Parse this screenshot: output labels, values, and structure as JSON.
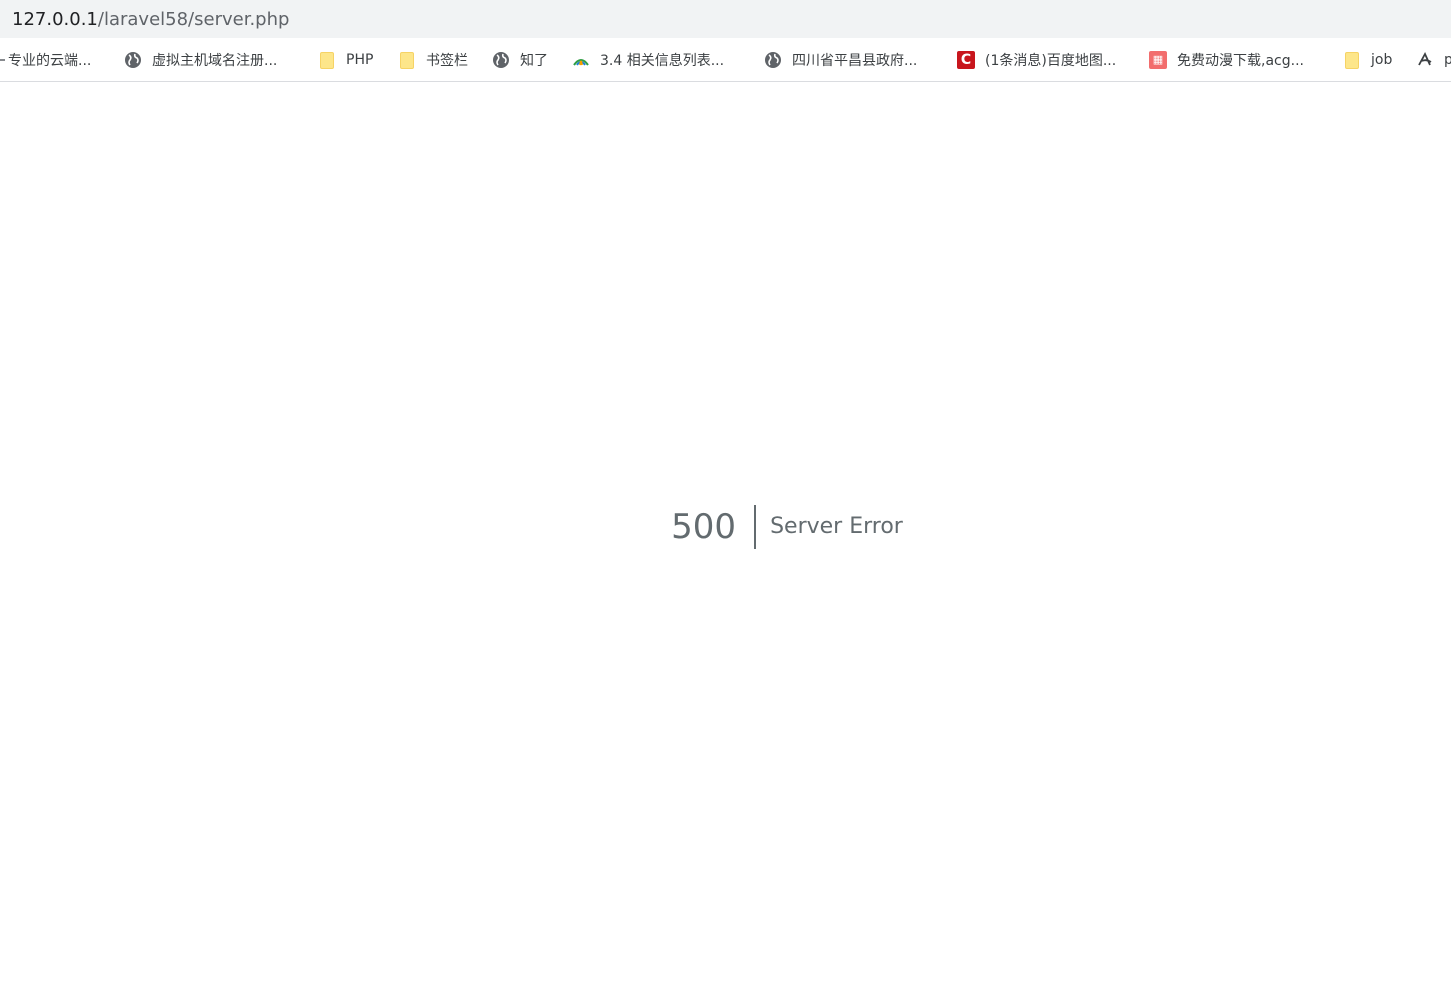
{
  "address_bar": {
    "host": "127.0.0.1",
    "path": "/laravel58/server.php"
  },
  "bookmarks": [
    {
      "label": "专业的云端...",
      "icon": "partial-icon"
    },
    {
      "label": "虚拟主机域名注册...",
      "icon": "globe-icon"
    },
    {
      "label": "PHP",
      "icon": "folder-icon"
    },
    {
      "label": "书签栏",
      "icon": "folder-icon"
    },
    {
      "label": "知了",
      "icon": "globe-icon"
    },
    {
      "label": "3.4 相关信息列表...",
      "icon": "site-logo-icon"
    },
    {
      "label": "四川省平昌县政府...",
      "icon": "globe-icon"
    },
    {
      "label": "(1条消息)百度地图...",
      "icon": "csdn-logo-icon"
    },
    {
      "label": "免费动漫下载,acg...",
      "icon": "site-logo-icon"
    },
    {
      "label": "job",
      "icon": "folder-icon"
    },
    {
      "label": "p",
      "icon": "site-logo-icon"
    }
  ],
  "error": {
    "code": "500",
    "message": "Server Error"
  },
  "colors": {
    "error_text": "#636b6f",
    "toolbar_bg": "#f1f3f4",
    "folder": "#fde68a",
    "csdn_red": "#c8161d"
  }
}
